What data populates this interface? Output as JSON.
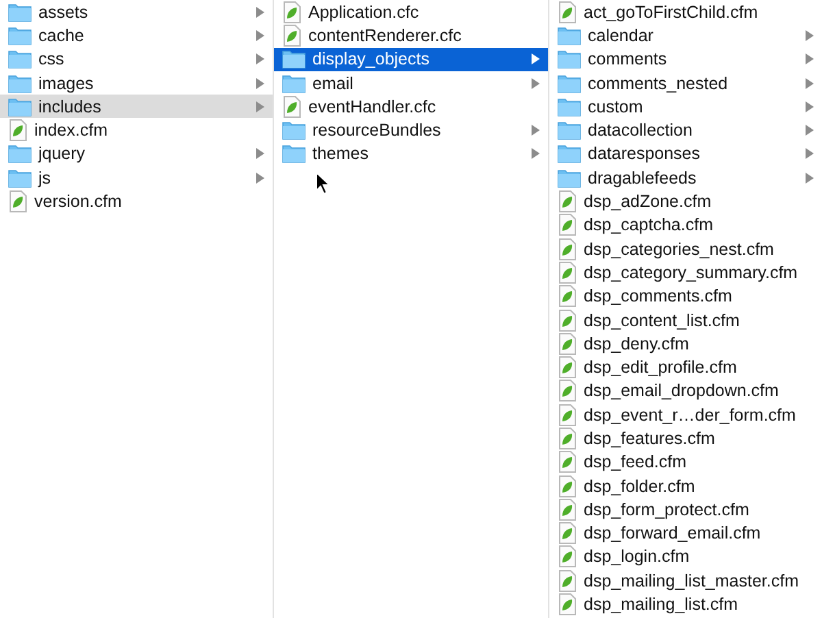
{
  "columns": [
    {
      "focused": false,
      "items": [
        {
          "name": "assets",
          "kind": "folder",
          "selected": false
        },
        {
          "name": "cache",
          "kind": "folder",
          "selected": false
        },
        {
          "name": "css",
          "kind": "folder",
          "selected": false
        },
        {
          "name": "images",
          "kind": "folder",
          "selected": false
        },
        {
          "name": "includes",
          "kind": "folder",
          "selected": true
        },
        {
          "name": "index.cfm",
          "kind": "file",
          "selected": false
        },
        {
          "name": "jquery",
          "kind": "folder",
          "selected": false
        },
        {
          "name": "js",
          "kind": "folder",
          "selected": false
        },
        {
          "name": "version.cfm",
          "kind": "file",
          "selected": false
        }
      ]
    },
    {
      "focused": true,
      "items": [
        {
          "name": "Application.cfc",
          "kind": "file",
          "selected": false
        },
        {
          "name": "contentRenderer.cfc",
          "kind": "file",
          "selected": false
        },
        {
          "name": "display_objects",
          "kind": "folder",
          "selected": true
        },
        {
          "name": "email",
          "kind": "folder",
          "selected": false
        },
        {
          "name": "eventHandler.cfc",
          "kind": "file",
          "selected": false
        },
        {
          "name": "resourceBundles",
          "kind": "folder",
          "selected": false
        },
        {
          "name": "themes",
          "kind": "folder",
          "selected": false
        }
      ]
    },
    {
      "items": [
        {
          "name": "act_goToFirstChild.cfm",
          "kind": "file",
          "selected": false
        },
        {
          "name": "calendar",
          "kind": "folder",
          "selected": false
        },
        {
          "name": "comments",
          "kind": "folder",
          "selected": false
        },
        {
          "name": "comments_nested",
          "kind": "folder",
          "selected": false
        },
        {
          "name": "custom",
          "kind": "folder",
          "selected": false
        },
        {
          "name": "datacollection",
          "kind": "folder",
          "selected": false
        },
        {
          "name": "dataresponses",
          "kind": "folder",
          "selected": false
        },
        {
          "name": "dragablefeeds",
          "kind": "folder",
          "selected": false
        },
        {
          "name": "dsp_adZone.cfm",
          "kind": "file",
          "selected": false
        },
        {
          "name": "dsp_captcha.cfm",
          "kind": "file",
          "selected": false
        },
        {
          "name": "dsp_categories_nest.cfm",
          "kind": "file",
          "selected": false
        },
        {
          "name": "dsp_category_summary.cfm",
          "kind": "file",
          "selected": false
        },
        {
          "name": "dsp_comments.cfm",
          "kind": "file",
          "selected": false
        },
        {
          "name": "dsp_content_list.cfm",
          "kind": "file",
          "selected": false
        },
        {
          "name": "dsp_deny.cfm",
          "kind": "file",
          "selected": false
        },
        {
          "name": "dsp_edit_profile.cfm",
          "kind": "file",
          "selected": false
        },
        {
          "name": "dsp_email_dropdown.cfm",
          "kind": "file",
          "selected": false
        },
        {
          "name": "dsp_event_r…der_form.cfm",
          "kind": "file",
          "selected": false
        },
        {
          "name": "dsp_features.cfm",
          "kind": "file",
          "selected": false
        },
        {
          "name": "dsp_feed.cfm",
          "kind": "file",
          "selected": false
        },
        {
          "name": "dsp_folder.cfm",
          "kind": "file",
          "selected": false
        },
        {
          "name": "dsp_form_protect.cfm",
          "kind": "file",
          "selected": false
        },
        {
          "name": "dsp_forward_email.cfm",
          "kind": "file",
          "selected": false
        },
        {
          "name": "dsp_login.cfm",
          "kind": "file",
          "selected": false
        },
        {
          "name": "dsp_mailing_list_master.cfm",
          "kind": "file",
          "selected": false
        },
        {
          "name": "dsp_mailing_list.cfm",
          "kind": "file",
          "selected": false
        }
      ]
    }
  ]
}
